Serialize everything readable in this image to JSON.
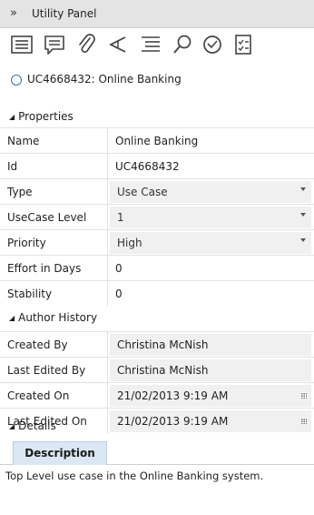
{
  "panel": {
    "chevron": "»",
    "title": "Utility Panel"
  },
  "toolbar": {
    "icons": [
      "list-view-icon",
      "comment-icon",
      "paperclip-icon",
      "share-icon",
      "indent-list-icon",
      "search-icon",
      "clock-icon",
      "checklist-icon"
    ]
  },
  "item": {
    "label": "UC4668432: Online Banking"
  },
  "sections": {
    "properties": "Properties",
    "author_history": "Author History",
    "details": "Details"
  },
  "properties": {
    "name": {
      "label": "Name",
      "value": "Online Banking"
    },
    "id": {
      "label": "Id",
      "value": "UC4668432"
    },
    "type": {
      "label": "Type",
      "value": "Use Case"
    },
    "usecase_level": {
      "label": "UseCase Level",
      "value": "1"
    },
    "priority": {
      "label": "Priority",
      "value": "High"
    },
    "effort": {
      "label": "Effort in Days",
      "value": "0"
    },
    "stability": {
      "label": "Stability",
      "value": "0"
    }
  },
  "author_history": {
    "created_by": {
      "label": "Created By",
      "value": "Christina McNish"
    },
    "last_edited_by": {
      "label": "Last Edited By",
      "value": "Christina McNish"
    },
    "created_on": {
      "label": "Created On",
      "value": "21/02/2013 9:19 AM"
    },
    "last_edited_on": {
      "label": "Last Edited On",
      "value": "21/02/2013 9:19 AM"
    }
  },
  "details": {
    "tab_label": "Description",
    "description": "Top Level use case in the Online Banking system."
  },
  "colors": {
    "accent": "#2f6fc0",
    "tab_bg": "#dbe8f4",
    "field_bg": "#f0f0f0"
  }
}
